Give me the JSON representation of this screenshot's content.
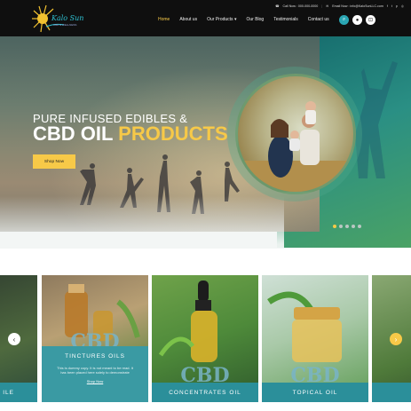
{
  "brand": {
    "name": "Kalo Sun",
    "tagline": "CBD & WELLNESS",
    "color": "#2fc1d2"
  },
  "topbar": {
    "phone": "Call Now : 000-000-0000",
    "email": "Email Now : info@KaloSunLLC.com"
  },
  "nav": {
    "items": [
      "Home",
      "About us",
      "Our Products",
      "Our Blog",
      "Testimonials",
      "Contact us"
    ],
    "active_index": 0
  },
  "icons": {
    "search": "search-icon",
    "user": "user-icon",
    "cart": "cart-icon"
  },
  "hero": {
    "line1": "PURE INFUSED EDIBLES &",
    "line2_white": "CBD OIL",
    "line2_yellow": "PRODUCTS",
    "button": "Shop Now",
    "slides": 5,
    "active_slide": 0
  },
  "products": [
    {
      "title": "TINCTURES OILS",
      "cbd": "CBD",
      "desc": "This is dummy copy. It is not meant to be read. It has been placed here solely to demonstrate",
      "link": "Shop Now",
      "expanded": true
    },
    {
      "title": "CONCENTRATES OIL",
      "cbd": "CBD"
    },
    {
      "title": "TOPICAL OIL",
      "cbd": "CBD"
    }
  ],
  "partial_left_label": "ILE",
  "colors": {
    "accent": "#f7c948",
    "teal": "#2b8f9a",
    "header": "#0f0f0f"
  }
}
